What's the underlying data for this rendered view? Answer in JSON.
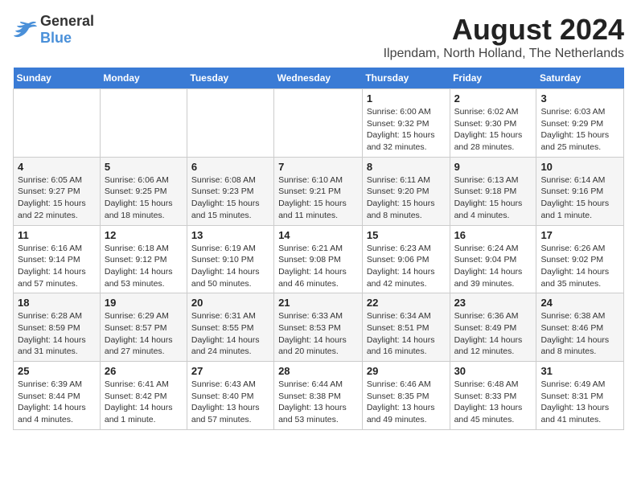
{
  "logo": {
    "text_general": "General",
    "text_blue": "Blue"
  },
  "title": "August 2024",
  "subtitle": "Ilpendam, North Holland, The Netherlands",
  "days_of_week": [
    "Sunday",
    "Monday",
    "Tuesday",
    "Wednesday",
    "Thursday",
    "Friday",
    "Saturday"
  ],
  "weeks": [
    [
      {
        "day": "",
        "info": ""
      },
      {
        "day": "",
        "info": ""
      },
      {
        "day": "",
        "info": ""
      },
      {
        "day": "",
        "info": ""
      },
      {
        "day": "1",
        "info": "Sunrise: 6:00 AM\nSunset: 9:32 PM\nDaylight: 15 hours\nand 32 minutes."
      },
      {
        "day": "2",
        "info": "Sunrise: 6:02 AM\nSunset: 9:30 PM\nDaylight: 15 hours\nand 28 minutes."
      },
      {
        "day": "3",
        "info": "Sunrise: 6:03 AM\nSunset: 9:29 PM\nDaylight: 15 hours\nand 25 minutes."
      }
    ],
    [
      {
        "day": "4",
        "info": "Sunrise: 6:05 AM\nSunset: 9:27 PM\nDaylight: 15 hours\nand 22 minutes."
      },
      {
        "day": "5",
        "info": "Sunrise: 6:06 AM\nSunset: 9:25 PM\nDaylight: 15 hours\nand 18 minutes."
      },
      {
        "day": "6",
        "info": "Sunrise: 6:08 AM\nSunset: 9:23 PM\nDaylight: 15 hours\nand 15 minutes."
      },
      {
        "day": "7",
        "info": "Sunrise: 6:10 AM\nSunset: 9:21 PM\nDaylight: 15 hours\nand 11 minutes."
      },
      {
        "day": "8",
        "info": "Sunrise: 6:11 AM\nSunset: 9:20 PM\nDaylight: 15 hours\nand 8 minutes."
      },
      {
        "day": "9",
        "info": "Sunrise: 6:13 AM\nSunset: 9:18 PM\nDaylight: 15 hours\nand 4 minutes."
      },
      {
        "day": "10",
        "info": "Sunrise: 6:14 AM\nSunset: 9:16 PM\nDaylight: 15 hours\nand 1 minute."
      }
    ],
    [
      {
        "day": "11",
        "info": "Sunrise: 6:16 AM\nSunset: 9:14 PM\nDaylight: 14 hours\nand 57 minutes."
      },
      {
        "day": "12",
        "info": "Sunrise: 6:18 AM\nSunset: 9:12 PM\nDaylight: 14 hours\nand 53 minutes."
      },
      {
        "day": "13",
        "info": "Sunrise: 6:19 AM\nSunset: 9:10 PM\nDaylight: 14 hours\nand 50 minutes."
      },
      {
        "day": "14",
        "info": "Sunrise: 6:21 AM\nSunset: 9:08 PM\nDaylight: 14 hours\nand 46 minutes."
      },
      {
        "day": "15",
        "info": "Sunrise: 6:23 AM\nSunset: 9:06 PM\nDaylight: 14 hours\nand 42 minutes."
      },
      {
        "day": "16",
        "info": "Sunrise: 6:24 AM\nSunset: 9:04 PM\nDaylight: 14 hours\nand 39 minutes."
      },
      {
        "day": "17",
        "info": "Sunrise: 6:26 AM\nSunset: 9:02 PM\nDaylight: 14 hours\nand 35 minutes."
      }
    ],
    [
      {
        "day": "18",
        "info": "Sunrise: 6:28 AM\nSunset: 8:59 PM\nDaylight: 14 hours\nand 31 minutes."
      },
      {
        "day": "19",
        "info": "Sunrise: 6:29 AM\nSunset: 8:57 PM\nDaylight: 14 hours\nand 27 minutes."
      },
      {
        "day": "20",
        "info": "Sunrise: 6:31 AM\nSunset: 8:55 PM\nDaylight: 14 hours\nand 24 minutes."
      },
      {
        "day": "21",
        "info": "Sunrise: 6:33 AM\nSunset: 8:53 PM\nDaylight: 14 hours\nand 20 minutes."
      },
      {
        "day": "22",
        "info": "Sunrise: 6:34 AM\nSunset: 8:51 PM\nDaylight: 14 hours\nand 16 minutes."
      },
      {
        "day": "23",
        "info": "Sunrise: 6:36 AM\nSunset: 8:49 PM\nDaylight: 14 hours\nand 12 minutes."
      },
      {
        "day": "24",
        "info": "Sunrise: 6:38 AM\nSunset: 8:46 PM\nDaylight: 14 hours\nand 8 minutes."
      }
    ],
    [
      {
        "day": "25",
        "info": "Sunrise: 6:39 AM\nSunset: 8:44 PM\nDaylight: 14 hours\nand 4 minutes."
      },
      {
        "day": "26",
        "info": "Sunrise: 6:41 AM\nSunset: 8:42 PM\nDaylight: 14 hours\nand 1 minute."
      },
      {
        "day": "27",
        "info": "Sunrise: 6:43 AM\nSunset: 8:40 PM\nDaylight: 13 hours\nand 57 minutes."
      },
      {
        "day": "28",
        "info": "Sunrise: 6:44 AM\nSunset: 8:38 PM\nDaylight: 13 hours\nand 53 minutes."
      },
      {
        "day": "29",
        "info": "Sunrise: 6:46 AM\nSunset: 8:35 PM\nDaylight: 13 hours\nand 49 minutes."
      },
      {
        "day": "30",
        "info": "Sunrise: 6:48 AM\nSunset: 8:33 PM\nDaylight: 13 hours\nand 45 minutes."
      },
      {
        "day": "31",
        "info": "Sunrise: 6:49 AM\nSunset: 8:31 PM\nDaylight: 13 hours\nand 41 minutes."
      }
    ]
  ]
}
